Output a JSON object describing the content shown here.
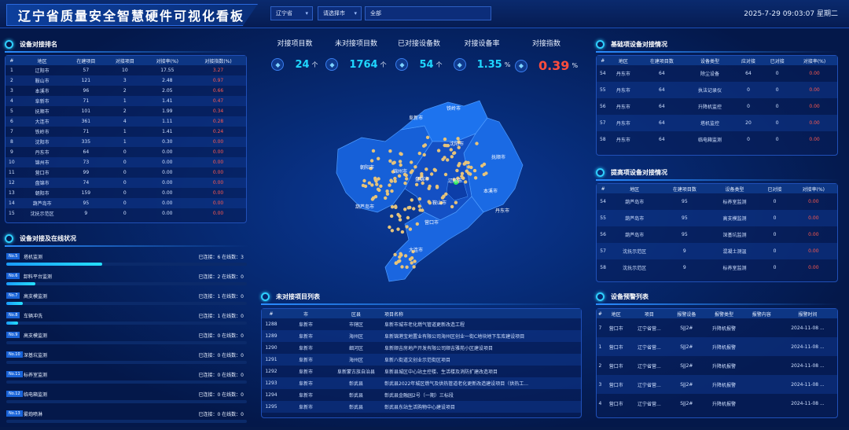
{
  "header": {
    "title": "辽宁省质量安全智慧硬件可视化看板",
    "province_select": "辽宁省",
    "city_select": "请选择市",
    "district_select": "全部",
    "datetime": "2025-7-29 09:03:07 星期二"
  },
  "stats": [
    {
      "label": "对接项目数",
      "value": "24",
      "unit": "个",
      "icon": "building-icon"
    },
    {
      "label": "未对接项目数",
      "value": "1764",
      "unit": "个",
      "icon": "list-icon"
    },
    {
      "label": "已对接设备数",
      "value": "54",
      "unit": "个",
      "icon": "device-icon"
    },
    {
      "label": "对接设备率",
      "value": "1.35",
      "unit": "%",
      "icon": "pie-icon"
    },
    {
      "label": "对接指数",
      "value": "0.39",
      "unit": "%",
      "icon": "shield-icon"
    }
  ],
  "ranking": {
    "title": "设备对接排名",
    "headers": [
      "#",
      "地区",
      "在建项目",
      "对接项目",
      "对接率(%)",
      "对接指数(%)"
    ],
    "rows": [
      [
        "1",
        "辽阳市",
        "57",
        "10",
        "17.55",
        "3.27"
      ],
      [
        "2",
        "鞍山市",
        "121",
        "3",
        "2.48",
        "0.97"
      ],
      [
        "3",
        "本溪市",
        "96",
        "2",
        "2.05",
        "0.66"
      ],
      [
        "4",
        "阜新市",
        "71",
        "1",
        "1.41",
        "0.47"
      ],
      [
        "5",
        "抚顺市",
        "101",
        "2",
        "1.99",
        "0.34"
      ],
      [
        "6",
        "大连市",
        "361",
        "4",
        "1.11",
        "0.28"
      ],
      [
        "7",
        "铁岭市",
        "71",
        "1",
        "1.41",
        "0.24"
      ],
      [
        "8",
        "沈阳市",
        "335",
        "1",
        "0.30",
        "0.00"
      ],
      [
        "9",
        "丹东市",
        "64",
        "0",
        "0.00",
        "0.00"
      ],
      [
        "10",
        "锦州市",
        "73",
        "0",
        "0.00",
        "0.00"
      ],
      [
        "11",
        "营口市",
        "99",
        "0",
        "0.00",
        "0.00"
      ],
      [
        "12",
        "盘锦市",
        "74",
        "0",
        "0.00",
        "0.00"
      ],
      [
        "13",
        "朝阳市",
        "159",
        "0",
        "0.00",
        "0.00"
      ],
      [
        "14",
        "葫芦岛市",
        "95",
        "0",
        "0.00",
        "0.00"
      ],
      [
        "15",
        "沈抚示范区",
        "9",
        "0",
        "0.00",
        "0.00"
      ]
    ]
  },
  "online": {
    "title": "设备对接及在线状况",
    "items": [
      {
        "tag": "No.5",
        "name": "塔机监测",
        "conn": "已连接：6 在线数：3",
        "ratio": 0.4
      },
      {
        "tag": "No.6",
        "name": "卸料平台监测",
        "conn": "已连接：2 在线数：0",
        "ratio": 0.12
      },
      {
        "tag": "No.7",
        "name": "高支模监测",
        "conn": "已连接：1 在线数：0",
        "ratio": 0.07
      },
      {
        "tag": "No.8",
        "name": "车辆冲洗",
        "conn": "已连接：1 在线数：0",
        "ratio": 0.05
      },
      {
        "tag": "No.9",
        "name": "高支模监测",
        "conn": "已连接：0 在线数：0",
        "ratio": 0
      },
      {
        "tag": "No.10",
        "name": "深基坑监测",
        "conn": "已连接：0 在线数：0",
        "ratio": 0
      },
      {
        "tag": "No.11",
        "name": "标养室监测",
        "conn": "已连接：0 在线数：0",
        "ratio": 0
      },
      {
        "tag": "No.12",
        "name": "临电箱监测",
        "conn": "已连接：0 在线数：0",
        "ratio": 0
      },
      {
        "tag": "No.13",
        "name": "雾炮喷淋",
        "conn": "已连接：0 在线数：0",
        "ratio": 0
      }
    ]
  },
  "map_labels": [
    "铁岭市",
    "阜新市",
    "沈阳市",
    "抚顺市",
    "朝阳市",
    "锦州市",
    "盘锦市",
    "辽阳市",
    "本溪市",
    "葫芦岛市",
    "鞍山市",
    "丹东市",
    "营口市",
    "大连市"
  ],
  "unconnected": {
    "title": "未对接项目列表",
    "headers": [
      "#",
      "市",
      "区县",
      "项目名称"
    ],
    "rows": [
      [
        "1288",
        "阜新市",
        "市辖区",
        "阜新市城市老化燃气管道更新改造工程"
      ],
      [
        "1289",
        "阜新市",
        "海州区",
        "阜新锦港宝地置业有限公司海州区创业一街C地块地下车库建设项目"
      ],
      [
        "1290",
        "阜新市",
        "细河区",
        "阜新顺吉房地产开发有限公司顺吉雅苑小区建设项目"
      ],
      [
        "1291",
        "阜新市",
        "海州区",
        "阜新八街道文创业示范街区项目"
      ],
      [
        "1292",
        "阜新市",
        "阜新蒙古族自治县",
        "阜新县城区中心站主控楼、生活楼及消防扩建改造项目"
      ],
      [
        "1293",
        "阜新市",
        "彰武县",
        "彰武县2022年城区燃气及供热管道老化更新改造建设项目（供热工..."
      ],
      [
        "1294",
        "阜新市",
        "彰武县",
        "彰武县金融园2号（一期）三标段"
      ],
      [
        "1295",
        "阜新市",
        "彰武县",
        "彰武县东站生活购物中心建设项目"
      ]
    ]
  },
  "basic": {
    "title": "基础项设备对接情况",
    "headers": [
      "#",
      "地区",
      "在建项目数",
      "设备类型",
      "应对接",
      "已对接",
      "对接率(%)"
    ],
    "rows": [
      [
        "54",
        "丹东市",
        "64",
        "除尘设备",
        "64",
        "0",
        "0.00"
      ],
      [
        "55",
        "丹东市",
        "64",
        "执法记录仪",
        "0",
        "0",
        "0.00"
      ],
      [
        "56",
        "丹东市",
        "64",
        "升降机监控",
        "0",
        "0",
        "0.00"
      ],
      [
        "57",
        "丹东市",
        "64",
        "塔机监控",
        "20",
        "0",
        "0.00"
      ],
      [
        "58",
        "丹东市",
        "64",
        "临电箱监测",
        "0",
        "0",
        "0.00"
      ]
    ]
  },
  "improve": {
    "title": "提高项设备对接情况",
    "headers": [
      "#",
      "地区",
      "在建项目数",
      "设备类型",
      "已对接",
      "对接率(%)"
    ],
    "rows": [
      [
        "54",
        "葫芦岛市",
        "95",
        "标养室监测",
        "0",
        "0.00"
      ],
      [
        "55",
        "葫芦岛市",
        "95",
        "高支模监测",
        "0",
        "0.00"
      ],
      [
        "56",
        "葫芦岛市",
        "95",
        "深基坑监测",
        "0",
        "0.00"
      ],
      [
        "57",
        "沈抚示范区",
        "9",
        "混凝土测温",
        "0",
        "0.00"
      ],
      [
        "58",
        "沈抚示范区",
        "9",
        "标养室监测",
        "0",
        "0.00"
      ]
    ]
  },
  "alarm": {
    "title": "设备预警列表",
    "headers": [
      "#",
      "地区",
      "项目",
      "报警设备",
      "报警类型",
      "报警内容",
      "报警时间"
    ],
    "rows": [
      [
        "7",
        "营口市",
        "辽宁省营...",
        "SJJ2#",
        "升降机报警",
        "",
        "2024-11-08 ..."
      ],
      [
        "1",
        "营口市",
        "辽宁省营...",
        "SJJ2#",
        "升降机报警",
        "",
        "2024-11-08 ..."
      ],
      [
        "2",
        "营口市",
        "辽宁省营...",
        "SJJ2#",
        "升降机报警",
        "",
        "2024-11-08 ..."
      ],
      [
        "3",
        "营口市",
        "辽宁省营...",
        "SJJ2#",
        "升降机报警",
        "",
        "2024-11-08 ..."
      ],
      [
        "4",
        "营口市",
        "辽宁省营...",
        "SJJ2#",
        "升降机报警",
        "",
        "2024-11-08 ..."
      ]
    ]
  },
  "colors": {
    "accent": "#1fd6ff",
    "danger": "#ff4d3d",
    "panel": "#0d3684"
  }
}
